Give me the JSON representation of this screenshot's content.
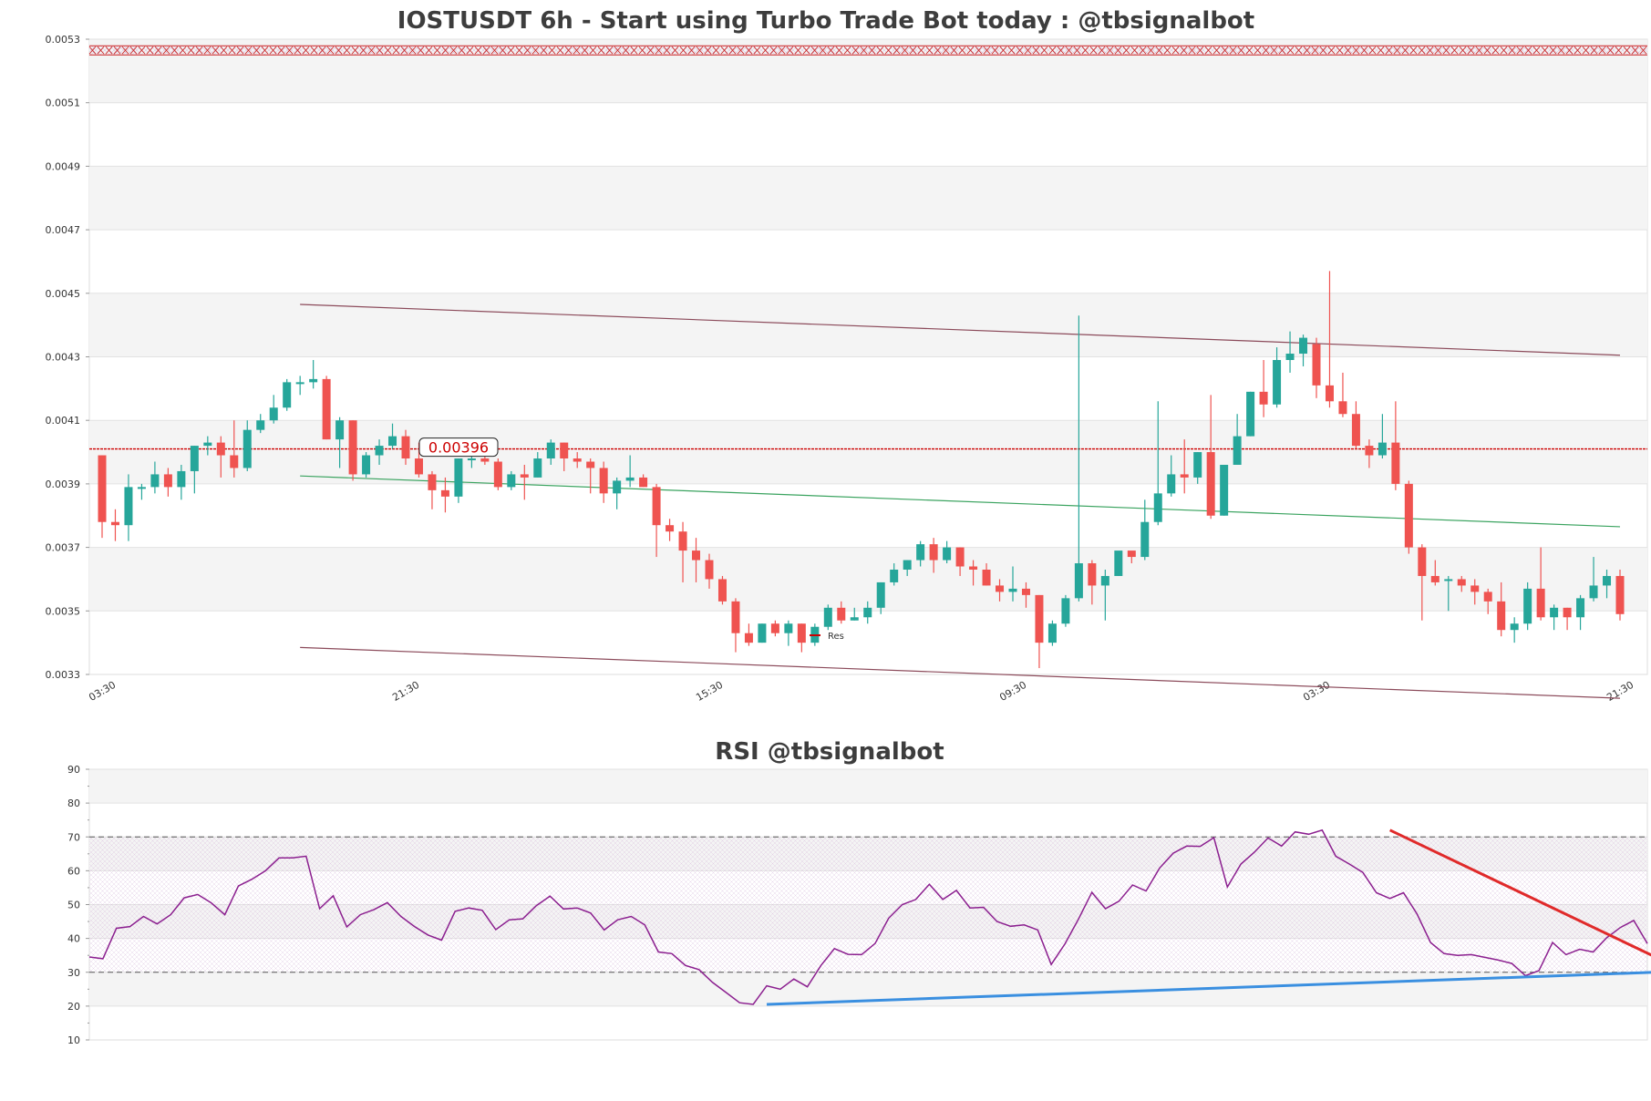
{
  "chart_data": [
    {
      "type": "candlestick",
      "title": "IOSTUSDT 6h - Start using Turbo Trade Bot today : @tbsignalbot",
      "ylim": [
        0.0033,
        0.0053
      ],
      "y_ticks": [
        "0.0053",
        "0.0051",
        "0.0049",
        "0.0047",
        "0.0045",
        "0.0043",
        "0.0041",
        "0.0039",
        "0.0037",
        "0.0035",
        "0.0033"
      ],
      "x_ticks": [
        "03:30",
        "21:30",
        "15:30",
        "09:30",
        "03:30",
        "21:30"
      ],
      "x_tick_index": [
        0,
        23,
        46,
        69,
        92,
        115
      ],
      "current_price_label": "0.00396",
      "current_price_line": 0.00401,
      "top_line": 0.005265,
      "legend": {
        "label": "Res",
        "placement": "bottom-center"
      },
      "channel": {
        "upper": [
          [
            15,
            0.004465
          ],
          [
            115,
            0.004305
          ]
        ],
        "middle": [
          [
            15,
            0.003925
          ],
          [
            115,
            0.003765
          ]
        ],
        "lower": [
          [
            15,
            0.003385
          ],
          [
            115,
            0.003225
          ]
        ]
      },
      "colors": {
        "up": "#26a69a",
        "down": "#ef5350",
        "channel": "#8b4a5a",
        "mid": "#3aa35f",
        "price_line": "#cc0000"
      },
      "ohlc": [
        [
          0.00399,
          0.00399,
          0.00373,
          0.00378
        ],
        [
          0.00378,
          0.00382,
          0.00372,
          0.00377
        ],
        [
          0.00377,
          0.00393,
          0.00372,
          0.00389
        ],
        [
          0.00389,
          0.0039,
          0.00385,
          0.00389
        ],
        [
          0.00389,
          0.00397,
          0.00387,
          0.00393
        ],
        [
          0.00393,
          0.00395,
          0.00386,
          0.00389
        ],
        [
          0.00389,
          0.00396,
          0.00385,
          0.00394
        ],
        [
          0.00394,
          0.00402,
          0.00387,
          0.00402
        ],
        [
          0.00402,
          0.00405,
          0.00399,
          0.00403
        ],
        [
          0.00403,
          0.00405,
          0.00392,
          0.00399
        ],
        [
          0.00399,
          0.0041,
          0.00392,
          0.00395
        ],
        [
          0.00395,
          0.0041,
          0.00394,
          0.00407
        ],
        [
          0.00407,
          0.00412,
          0.00406,
          0.0041
        ],
        [
          0.0041,
          0.00418,
          0.00409,
          0.00414
        ],
        [
          0.00414,
          0.00423,
          0.00413,
          0.00422
        ],
        [
          0.00422,
          0.00424,
          0.00418,
          0.00422
        ],
        [
          0.00422,
          0.00429,
          0.0042,
          0.00423
        ],
        [
          0.00423,
          0.00424,
          0.00404,
          0.00404
        ],
        [
          0.00404,
          0.00411,
          0.00395,
          0.0041
        ],
        [
          0.0041,
          0.0041,
          0.00391,
          0.00393
        ],
        [
          0.00393,
          0.004,
          0.00392,
          0.00399
        ],
        [
          0.00399,
          0.00404,
          0.00396,
          0.00402
        ],
        [
          0.00402,
          0.00409,
          0.00401,
          0.00405
        ],
        [
          0.00405,
          0.00407,
          0.00396,
          0.00398
        ],
        [
          0.00398,
          0.00403,
          0.00392,
          0.00393
        ],
        [
          0.00393,
          0.00394,
          0.00382,
          0.00388
        ],
        [
          0.00388,
          0.00392,
          0.00381,
          0.00386
        ],
        [
          0.00386,
          0.00398,
          0.00384,
          0.00398
        ],
        [
          0.00398,
          0.004,
          0.00395,
          0.00398
        ],
        [
          0.00398,
          0.004,
          0.00396,
          0.00397
        ],
        [
          0.00397,
          0.00398,
          0.00388,
          0.00389
        ],
        [
          0.00389,
          0.00394,
          0.00388,
          0.00393
        ],
        [
          0.00393,
          0.00396,
          0.00385,
          0.00392
        ],
        [
          0.00392,
          0.004,
          0.00392,
          0.00398
        ],
        [
          0.00398,
          0.00404,
          0.00396,
          0.00403
        ],
        [
          0.00403,
          0.00403,
          0.00394,
          0.00398
        ],
        [
          0.00398,
          0.004,
          0.00395,
          0.00397
        ],
        [
          0.00397,
          0.00398,
          0.00387,
          0.00395
        ],
        [
          0.00395,
          0.00397,
          0.00384,
          0.00387
        ],
        [
          0.00387,
          0.00392,
          0.00382,
          0.00391
        ],
        [
          0.00391,
          0.00399,
          0.00389,
          0.00392
        ],
        [
          0.00392,
          0.00393,
          0.00389,
          0.00389
        ],
        [
          0.00389,
          0.0039,
          0.00367,
          0.00377
        ],
        [
          0.00377,
          0.00379,
          0.00372,
          0.00375
        ],
        [
          0.00375,
          0.00378,
          0.00359,
          0.00369
        ],
        [
          0.00369,
          0.00373,
          0.00359,
          0.00366
        ],
        [
          0.00366,
          0.00368,
          0.00357,
          0.0036
        ],
        [
          0.0036,
          0.00361,
          0.00352,
          0.00353
        ],
        [
          0.00353,
          0.00354,
          0.00337,
          0.00343
        ],
        [
          0.00343,
          0.00346,
          0.00339,
          0.0034
        ],
        [
          0.0034,
          0.00346,
          0.0034,
          0.00346
        ],
        [
          0.00346,
          0.00347,
          0.00342,
          0.00343
        ],
        [
          0.00343,
          0.00347,
          0.00339,
          0.00346
        ],
        [
          0.00346,
          0.00346,
          0.00337,
          0.0034
        ],
        [
          0.0034,
          0.00346,
          0.00339,
          0.00345
        ],
        [
          0.00345,
          0.00352,
          0.00344,
          0.00351
        ],
        [
          0.00351,
          0.00353,
          0.00346,
          0.00347
        ],
        [
          0.00347,
          0.00351,
          0.00347,
          0.00348
        ],
        [
          0.00348,
          0.00353,
          0.00346,
          0.00351
        ],
        [
          0.00351,
          0.00359,
          0.00349,
          0.00359
        ],
        [
          0.00359,
          0.00365,
          0.00358,
          0.00363
        ],
        [
          0.00363,
          0.00366,
          0.00361,
          0.00366
        ],
        [
          0.00366,
          0.00372,
          0.00364,
          0.00371
        ],
        [
          0.00371,
          0.00373,
          0.00362,
          0.00366
        ],
        [
          0.00366,
          0.00372,
          0.00365,
          0.0037
        ],
        [
          0.0037,
          0.0037,
          0.00361,
          0.00364
        ],
        [
          0.00364,
          0.00366,
          0.00358,
          0.00363
        ],
        [
          0.00363,
          0.00365,
          0.00358,
          0.00358
        ],
        [
          0.00358,
          0.0036,
          0.00353,
          0.00356
        ],
        [
          0.00356,
          0.00364,
          0.00353,
          0.00357
        ],
        [
          0.00357,
          0.00359,
          0.00351,
          0.00355
        ],
        [
          0.00355,
          0.00355,
          0.00332,
          0.0034
        ],
        [
          0.0034,
          0.00347,
          0.00339,
          0.00346
        ],
        [
          0.00346,
          0.00355,
          0.00345,
          0.00354
        ],
        [
          0.00354,
          0.00443,
          0.00353,
          0.00365
        ],
        [
          0.00365,
          0.00366,
          0.00352,
          0.00358
        ],
        [
          0.00358,
          0.00363,
          0.00347,
          0.00361
        ],
        [
          0.00361,
          0.00368,
          0.00361,
          0.00369
        ],
        [
          0.00369,
          0.00368,
          0.00365,
          0.00367
        ],
        [
          0.00367,
          0.00385,
          0.00366,
          0.00378
        ],
        [
          0.00378,
          0.00416,
          0.00377,
          0.00387
        ],
        [
          0.00387,
          0.00399,
          0.00386,
          0.00393
        ],
        [
          0.00393,
          0.00404,
          0.00387,
          0.00392
        ],
        [
          0.00392,
          0.004,
          0.0039,
          0.004
        ],
        [
          0.004,
          0.00418,
          0.00379,
          0.0038
        ],
        [
          0.0038,
          0.00396,
          0.0038,
          0.00396
        ],
        [
          0.00396,
          0.00412,
          0.00396,
          0.00405
        ],
        [
          0.00405,
          0.00419,
          0.00405,
          0.00419
        ],
        [
          0.00419,
          0.00429,
          0.00411,
          0.00415
        ],
        [
          0.00415,
          0.00433,
          0.00414,
          0.00429
        ],
        [
          0.00429,
          0.00438,
          0.00425,
          0.00431
        ],
        [
          0.00431,
          0.00437,
          0.00427,
          0.00436
        ],
        [
          0.00434,
          0.00436,
          0.00417,
          0.00421
        ],
        [
          0.00421,
          0.00457,
          0.00414,
          0.00416
        ],
        [
          0.00416,
          0.00425,
          0.00411,
          0.00412
        ],
        [
          0.00412,
          0.00416,
          0.00401,
          0.00402
        ],
        [
          0.00402,
          0.00404,
          0.00395,
          0.00399
        ],
        [
          0.00399,
          0.00412,
          0.00398,
          0.00403
        ],
        [
          0.00403,
          0.00416,
          0.00388,
          0.0039
        ],
        [
          0.0039,
          0.00391,
          0.00368,
          0.0037
        ],
        [
          0.0037,
          0.00371,
          0.00347,
          0.00361
        ],
        [
          0.00361,
          0.00366,
          0.00358,
          0.00359
        ],
        [
          0.0036,
          0.00361,
          0.0035,
          0.0036
        ],
        [
          0.0036,
          0.00361,
          0.00356,
          0.00358
        ],
        [
          0.00358,
          0.0036,
          0.00352,
          0.00356
        ],
        [
          0.00356,
          0.00357,
          0.00349,
          0.00353
        ],
        [
          0.00353,
          0.00359,
          0.00342,
          0.00344
        ],
        [
          0.00344,
          0.00348,
          0.0034,
          0.00346
        ],
        [
          0.00346,
          0.00359,
          0.00344,
          0.00357
        ],
        [
          0.00357,
          0.0037,
          0.00347,
          0.00348
        ],
        [
          0.00348,
          0.00352,
          0.00344,
          0.00351
        ],
        [
          0.00351,
          0.00351,
          0.00344,
          0.00348
        ],
        [
          0.00348,
          0.00355,
          0.00344,
          0.00354
        ],
        [
          0.00354,
          0.00367,
          0.00353,
          0.00358
        ],
        [
          0.00358,
          0.00363,
          0.00354,
          0.00361
        ],
        [
          0.00361,
          0.00363,
          0.00347,
          0.00349
        ]
      ]
    },
    {
      "type": "line",
      "title": "RSI @tbsignalbot",
      "ylim": [
        10,
        90
      ],
      "y_ticks": [
        "90",
        "80",
        "70",
        "60",
        "50",
        "40",
        "30",
        "20",
        "10"
      ],
      "overbought": 70,
      "oversold": 30,
      "colors": {
        "rsi": "#8b1f8f",
        "support": "#3a8fe0",
        "resistance": "#e02a2a"
      },
      "support_line": [
        [
          50,
          20.5
        ],
        [
          119,
          30.5
        ]
      ],
      "resistance_line": [
        [
          96,
          72
        ],
        [
          119,
          28
        ]
      ],
      "values": [
        34.5,
        34,
        43,
        43.5,
        46.5,
        44.3,
        47,
        52,
        53,
        50.5,
        47,
        55.5,
        57.5,
        60,
        63.8,
        63.8,
        64.3,
        48.8,
        52.6,
        43.4,
        47,
        48.5,
        50.6,
        46.5,
        43.5,
        41,
        39.5,
        48,
        49,
        48.3,
        42.6,
        45.5,
        45.8,
        49.7,
        52.5,
        48.7,
        49,
        47.5,
        42.5,
        45.5,
        46.5,
        44,
        36,
        35.5,
        32,
        30.8,
        27,
        24,
        21,
        20.5,
        26,
        25,
        28,
        25.7,
        32,
        37,
        35.3,
        35.2,
        38.5,
        46,
        50,
        51.5,
        56,
        51.5,
        54.2,
        49,
        49.2,
        45,
        43.6,
        44,
        42.5,
        32.3,
        38.3,
        45.6,
        53.6,
        48.8,
        51,
        55.8,
        54,
        60.8,
        65.2,
        67.3,
        67.2,
        69.8,
        55.2,
        62,
        65.5,
        69.7,
        67.3,
        71.5,
        70.8,
        72,
        64.3,
        62,
        59.5,
        53.5,
        51.8,
        53.5,
        47.2,
        38.8,
        35.5,
        35,
        35.2,
        34.4,
        33.6,
        32.6,
        29,
        30.5,
        38.8,
        35.2,
        36.8,
        36,
        40.2,
        43.2,
        45.3,
        38.5
      ]
    }
  ]
}
